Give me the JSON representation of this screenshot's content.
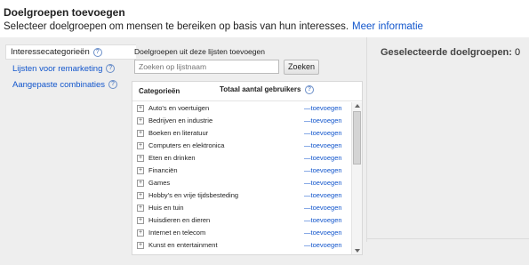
{
  "header": {
    "title": "Doelgroepen toevoegen",
    "subtitle": "Selecteer doelgroepen om mensen te bereiken op basis van hun interesses.",
    "more_info_link": "Meer informatie"
  },
  "sidebar": {
    "items": [
      {
        "label": "Interessecategorieën",
        "active": true
      },
      {
        "label": "Lijsten voor remarketing",
        "active": false
      },
      {
        "label": "Aangepaste combinaties",
        "active": false
      }
    ]
  },
  "panel": {
    "label": "Doelgroepen uit deze lijsten toevoegen",
    "search_placeholder": "Zoeken op lijstnaam",
    "search_button": "Zoeken",
    "col_categories": "Categorieën",
    "col_total_users": "Totaal aantal gebruikers",
    "rows": [
      {
        "label": "Auto's en voertuigen",
        "action": "—toevoegen"
      },
      {
        "label": "Bedrijven en industrie",
        "action": "—toevoegen"
      },
      {
        "label": "Boeken en literatuur",
        "action": "—toevoegen"
      },
      {
        "label": "Computers en elektronica",
        "action": "—toevoegen"
      },
      {
        "label": "Eten en drinken",
        "action": "—toevoegen"
      },
      {
        "label": "Financiën",
        "action": "—toevoegen"
      },
      {
        "label": "Games",
        "action": "—toevoegen"
      },
      {
        "label": "Hobby's en vrije tijdsbesteding",
        "action": "—toevoegen"
      },
      {
        "label": "Huis en tuin",
        "action": "—toevoegen"
      },
      {
        "label": "Huisdieren en dieren",
        "action": "—toevoegen"
      },
      {
        "label": "Internet en telecom",
        "action": "—toevoegen"
      },
      {
        "label": "Kunst en entertainment",
        "action": "—toevoegen"
      }
    ]
  },
  "selected": {
    "title": "Geselecteerde doelgroepen:",
    "count": "0"
  },
  "colors": {
    "link": "#1155cc",
    "background_gray": "#eeeeee"
  }
}
